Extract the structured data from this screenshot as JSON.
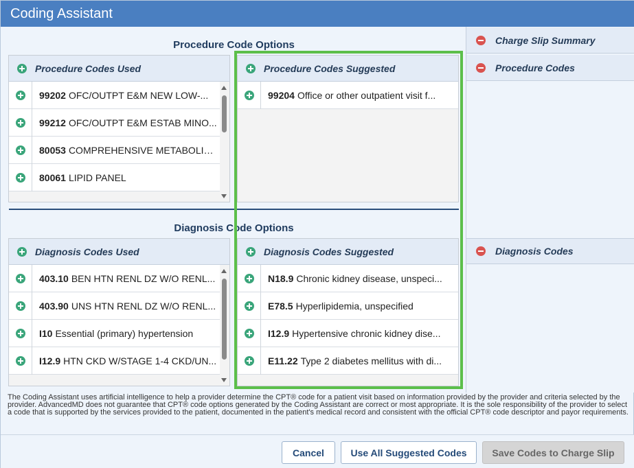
{
  "window": {
    "title": "Coding Assistant"
  },
  "procedure_options": {
    "title": "Procedure Code Options",
    "used": {
      "header": "Procedure Codes Used",
      "rows": [
        {
          "code": "99202",
          "desc": "OFC/OUTPT E&M NEW LOW-..."
        },
        {
          "code": "99212",
          "desc": "OFC/OUTPT E&M ESTAB MINO..."
        },
        {
          "code": "80053",
          "desc": "COMPREHENSIVE METABOLIC ..."
        },
        {
          "code": "80061",
          "desc": "LIPID PANEL"
        }
      ]
    },
    "suggested": {
      "header": "Procedure Codes Suggested",
      "rows": [
        {
          "code": "99204",
          "desc": "Office or other outpatient visit f..."
        }
      ]
    }
  },
  "diagnosis_options": {
    "title": "Diagnosis Code Options",
    "used": {
      "header": "Diagnosis Codes Used",
      "rows": [
        {
          "code": "403.10",
          "desc": "BEN HTN RENL DZ W/O RENL..."
        },
        {
          "code": "403.90",
          "desc": "UNS HTN RENL DZ W/O RENL..."
        },
        {
          "code": "I10",
          "desc": "Essential (primary) hypertension"
        },
        {
          "code": "I12.9",
          "desc": "HTN CKD W/STAGE 1-4 CKD/UN..."
        }
      ]
    },
    "suggested": {
      "header": "Diagnosis Codes Suggested",
      "rows": [
        {
          "code": "N18.9",
          "desc": "Chronic kidney disease, unspeci..."
        },
        {
          "code": "E78.5",
          "desc": "Hyperlipidemia, unspecified"
        },
        {
          "code": "I12.9",
          "desc": "Hypertensive chronic kidney dise..."
        },
        {
          "code": "E11.22",
          "desc": "Type 2 diabetes mellitus with di..."
        }
      ]
    }
  },
  "charge_slip": {
    "summary_label": "Charge Slip Summary",
    "procedure_label": "Procedure Codes",
    "diagnosis_label": "Diagnosis Codes"
  },
  "disclaimer": "The Coding Assistant uses artificial intelligence to help a provider determine the CPT® code for a patient visit based on information provided by the provider and criteria selected by the provider. AdvancedMD does not guarantee that CPT® code options generated by the Coding Assistant are correct or most appropriate. It is the sole responsibility of the provider to select a code that is supported by the services provided to the patient, documented in the patient's medical record and consistent with the official CPT® code descriptor and payor requirements.",
  "buttons": {
    "cancel": "Cancel",
    "use_all": "Use All Suggested Codes",
    "save": "Save Codes to Charge Slip"
  },
  "colors": {
    "titlebar": "#4a7fc1",
    "add_icon": "#3aa57a",
    "remove_icon": "#d9534f",
    "highlight": "#5cbf4a"
  }
}
